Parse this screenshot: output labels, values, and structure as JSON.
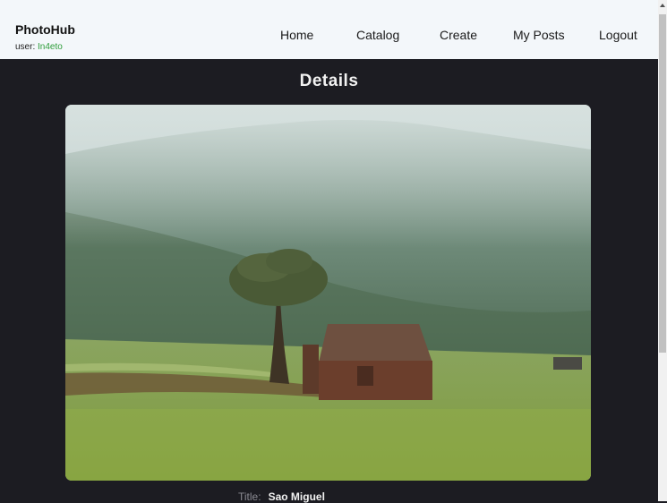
{
  "brand": {
    "title": "PhotoHub",
    "user_prefix": "user:",
    "username": "In4eto"
  },
  "nav": {
    "home": "Home",
    "catalog": "Catalog",
    "create": "Create",
    "my_posts": "My Posts",
    "logout": "Logout"
  },
  "page": {
    "title": "Details"
  },
  "details": {
    "title_label": "Title:",
    "title_value": "Sao Miguel"
  },
  "colors": {
    "header_bg": "#f3f7fa",
    "page_bg": "#1c1c22",
    "username": "#2e9d3a"
  }
}
